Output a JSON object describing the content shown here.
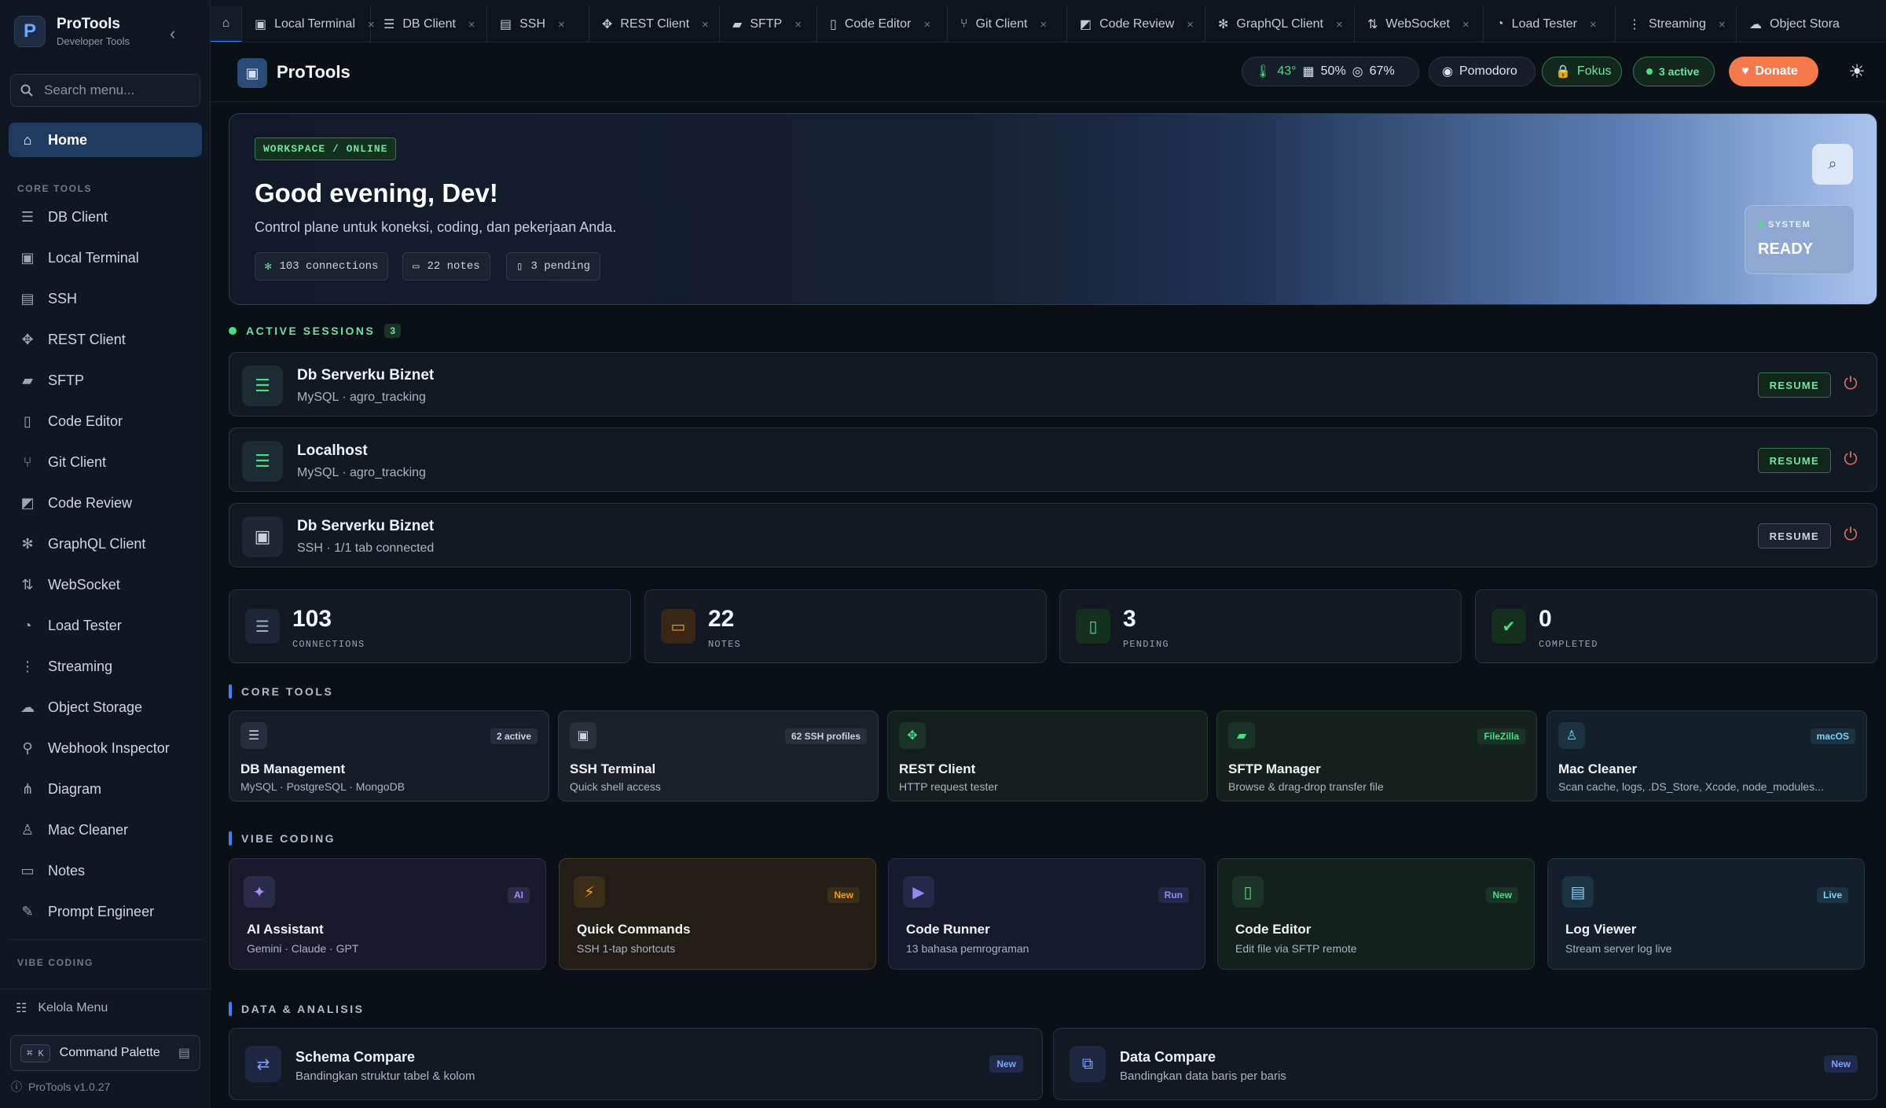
{
  "brand": {
    "name": "ProTools",
    "subtitle": "Developer Tools"
  },
  "search": {
    "placeholder": "Search menu..."
  },
  "sidebar": {
    "home": "Home",
    "core_section": "CORE TOOLS",
    "items": [
      "DB Client",
      "Local Terminal",
      "SSH",
      "REST Client",
      "SFTP",
      "Code Editor",
      "Git Client",
      "Code Review",
      "GraphQL Client",
      "WebSocket",
      "Load Tester",
      "Streaming",
      "Object Storage",
      "Webhook Inspector",
      "Diagram",
      "Mac Cleaner",
      "Notes",
      "Prompt Engineer"
    ],
    "vibe_section": "VIBE CODING",
    "manage": "Kelola Menu",
    "command_palette": "Command Palette",
    "kbd": "⌘ K",
    "version": "ProTools v1.0.27"
  },
  "tabs": [
    "Local Terminal",
    "DB Client",
    "SSH",
    "REST Client",
    "SFTP",
    "Code Editor",
    "Git Client",
    "Code Review",
    "GraphQL Client",
    "WebSocket",
    "Load Tester",
    "Streaming",
    "Object Stora"
  ],
  "header": {
    "title": "ProTools",
    "temp": "43°",
    "cpu": "50%",
    "mem": "67%",
    "pomodoro": "Pomodoro",
    "focus": "Fokus",
    "active": "3 active",
    "donate": "Donate"
  },
  "hero": {
    "badge": "WORKSPACE / ONLINE",
    "greeting": "Good evening, Dev!",
    "tagline": "Control plane untuk koneksi, coding, dan pekerjaan Anda.",
    "chips": [
      "103 connections",
      "22 notes",
      "3 pending"
    ],
    "system_label": "SYSTEM",
    "system_value": "READY"
  },
  "sessions": {
    "heading": "ACTIVE SESSIONS",
    "count": "3",
    "resume": "RESUME",
    "items": [
      {
        "title": "Db  Serverku Biznet",
        "sub": "MySQL · agro_tracking"
      },
      {
        "title": "Localhost",
        "sub": "MySQL · agro_tracking"
      },
      {
        "title": "Db  Serverku Biznet",
        "sub": "SSH · 1/1 tab connected"
      }
    ]
  },
  "stats": [
    {
      "value": "103",
      "label": "CONNECTIONS"
    },
    {
      "value": "22",
      "label": "NOTES"
    },
    {
      "value": "3",
      "label": "PENDING"
    },
    {
      "value": "0",
      "label": "COMPLETED"
    }
  ],
  "core_tools": {
    "heading": "CORE TOOLS",
    "cards": [
      {
        "title": "DB Management",
        "sub": "MySQL · PostgreSQL · MongoDB",
        "tag": "2 active"
      },
      {
        "title": "SSH Terminal",
        "sub": "Quick shell access",
        "tag": "62 SSH profiles"
      },
      {
        "title": "REST Client",
        "sub": "HTTP request tester",
        "tag": ""
      },
      {
        "title": "SFTP Manager",
        "sub": "Browse & drag-drop transfer file",
        "tag": "FileZilla"
      },
      {
        "title": "Mac Cleaner",
        "sub": "Scan cache, logs, .DS_Store, Xcode, node_modules...",
        "tag": "macOS"
      }
    ]
  },
  "vibe": {
    "heading": "VIBE CODING",
    "cards": [
      {
        "title": "AI Assistant",
        "sub": "Gemini · Claude · GPT",
        "tag": "AI"
      },
      {
        "title": "Quick Commands",
        "sub": "SSH 1-tap shortcuts",
        "tag": "New"
      },
      {
        "title": "Code Runner",
        "sub": "13 bahasa pemrograman",
        "tag": "Run"
      },
      {
        "title": "Code Editor",
        "sub": "Edit file via SFTP remote",
        "tag": "New"
      },
      {
        "title": "Log Viewer",
        "sub": "Stream server log live",
        "tag": "Live"
      }
    ]
  },
  "data": {
    "heading": "DATA & ANALISIS",
    "cards": [
      {
        "title": "Schema Compare",
        "sub": "Bandingkan struktur tabel & kolom",
        "tag": "New"
      },
      {
        "title": "Data Compare",
        "sub": "Bandingkan data baris per baris",
        "tag": "New"
      }
    ]
  },
  "colors": {
    "accent": "#3b82f6",
    "active_nav": "#1e3a5f",
    "donate": "#f47a4b",
    "success": "#4ade80"
  }
}
